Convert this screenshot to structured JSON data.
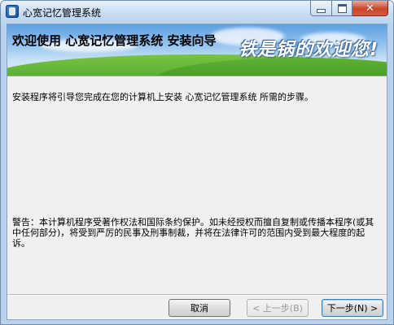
{
  "window": {
    "title": "心宽记忆管理系统"
  },
  "banner": {
    "title": "欢迎使用  心宽记忆管理系统  安装向导",
    "slogan": "铁是锅的欢迎您!"
  },
  "content": {
    "intro": "安装程序将引导您完成在您的计算机上安装  心宽记忆管理系统  所需的步骤。",
    "warning": "警告：本计算机程序受著作权法和国际条约保护。如未经授权而擅自复制或传播本程序(或其中任何部分)，将受到严厉的民事及刑事制裁，并将在法律许可的范围内受到最大程度的起诉。"
  },
  "buttons": {
    "cancel": "取消",
    "prev": "< 上一步(B)",
    "next": "下一步(N) >"
  },
  "icons": {
    "app": "installer-icon",
    "minimize": "minimize-icon",
    "maximize": "maximize-icon",
    "close": "close-icon"
  },
  "colors": {
    "close_button": "#c8452c",
    "sky": "#5d9fe0",
    "grass": "#3f9a23"
  }
}
